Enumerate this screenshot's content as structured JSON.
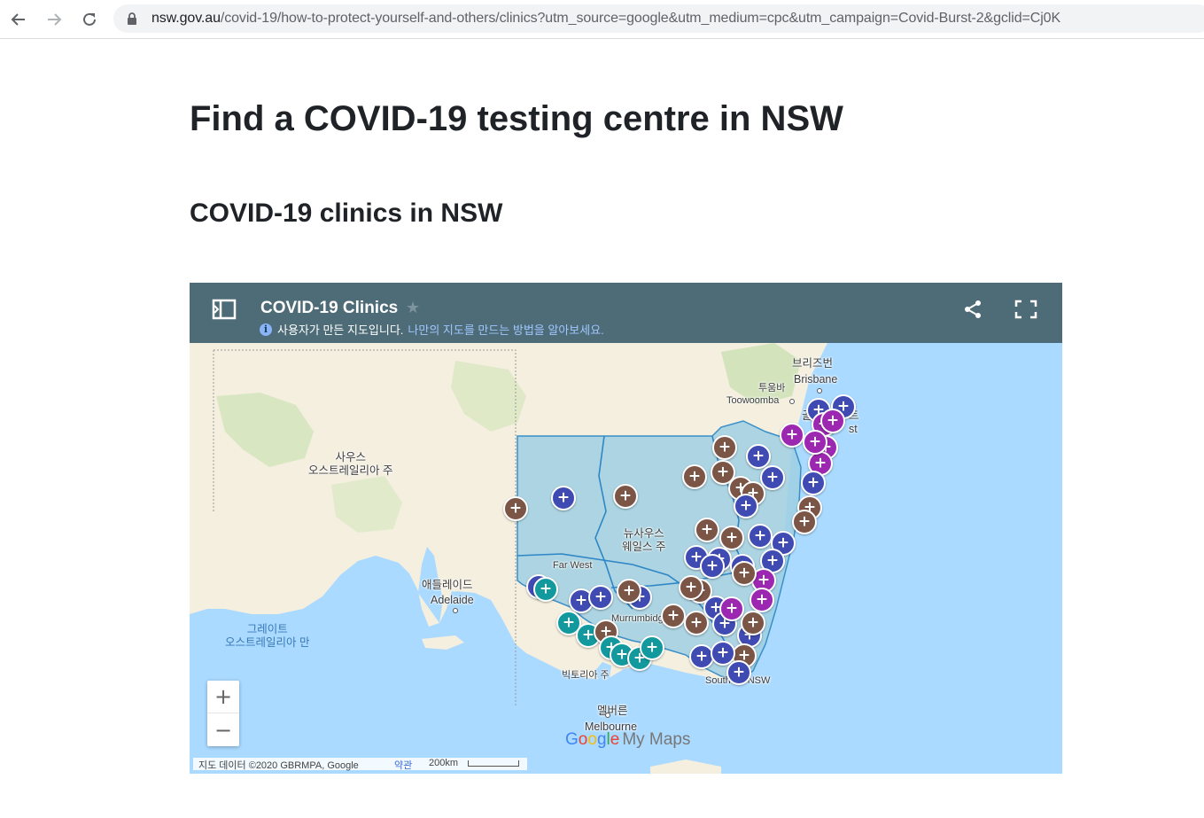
{
  "browser": {
    "url_domain": "nsw.gov.au",
    "url_path": "/covid-19/how-to-protect-yourself-and-others/clinics?utm_source=google&utm_medium=cpc&utm_campaign=Covid-Burst-2&gclid=Cj0K"
  },
  "page": {
    "title": "Find a COVID-19 testing centre in NSW",
    "subtitle": "COVID-19 clinics in NSW"
  },
  "map": {
    "title": "COVID-19 Clinics",
    "user_map_note": "사용자가 만든 지도입니다.",
    "learn_link": "나만의 지도를 만드는 방법을 알아보세요.",
    "labels": {
      "brisbane_ko": "브리즈번",
      "brisbane_en": "Brisbane",
      "toowoomba_ko": "투움바",
      "toowoomba_en": "Toowoomba",
      "gold_coast_partial": "골",
      "gold_coast_partial_2": "트",
      "gold_coast_partial_3": "st",
      "south_australia": "사우스\n오스트레일리아 주",
      "nsw": "뉴사우스\n웨일스 주",
      "far_west": "Far West",
      "adelaide_ko": "애들레이드",
      "adelaide_en": "Adelaide",
      "bight": "그레이트\n오스트레일리아 만",
      "murrumbidgee": "Murrumbidgee",
      "victoria": "빅토리아 주",
      "southern_nsw": "Southern NSW",
      "melbourne_ko": "멜버른",
      "melbourne_en": "Melbourne"
    },
    "zoom_in": "+",
    "zoom_out": "−",
    "watermark_google": "Google",
    "watermark_mymaps": "My Maps",
    "attribution": "지도 데이터 ©2020 GBRMPA, Google",
    "terms": "약관",
    "scale": "200km",
    "colors": {
      "header": "#4e6c77",
      "water": "#aadaff",
      "land": "#f3efe2",
      "nsw_fill": "#9fcfe3",
      "pin_brown": "#7b5546",
      "pin_blue": "#3f4bb2",
      "pin_purple": "#9c27b0",
      "pin_teal": "#11999e"
    }
  }
}
